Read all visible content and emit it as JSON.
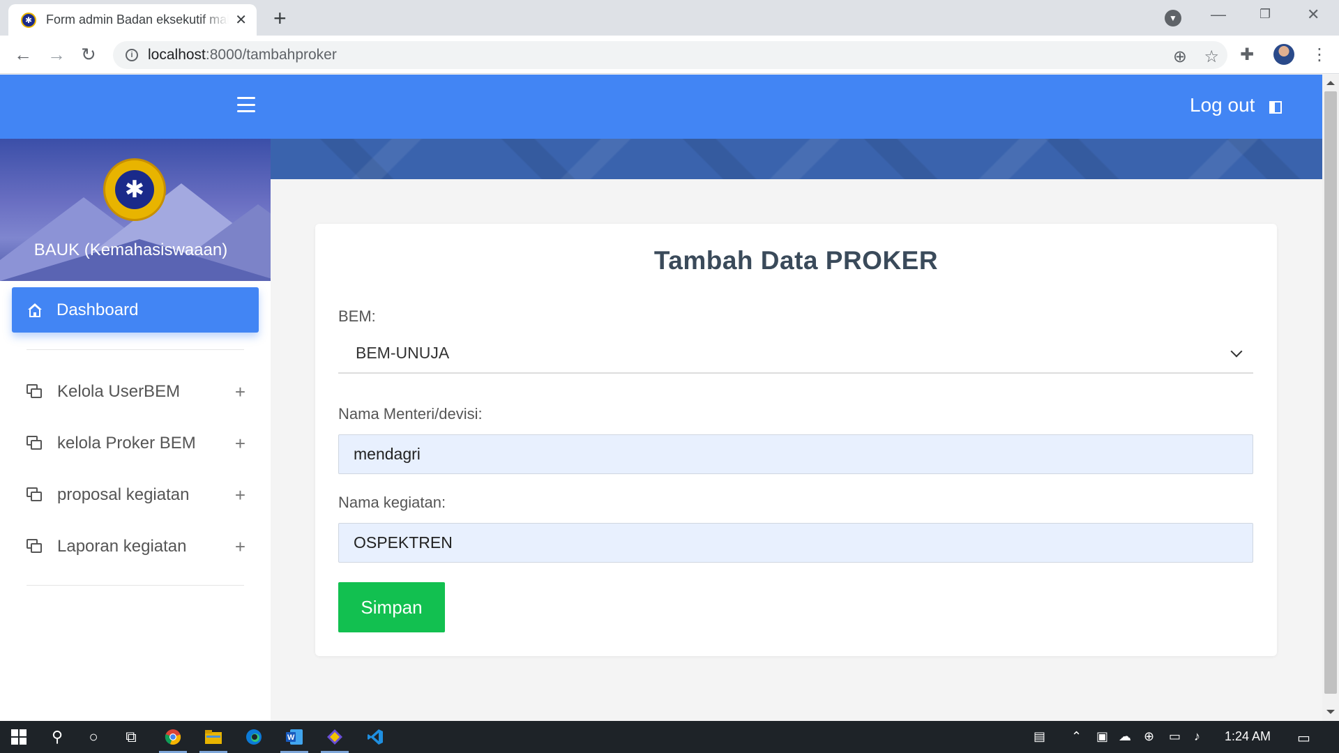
{
  "browser": {
    "tab_title": "Form admin Badan eksekutif mahasiswa",
    "url_host": "localhost",
    "url_path": ":8000/tambahproker",
    "new_tab_symbol": "+",
    "icons": [
      "back-arrow-icon",
      "forward-arrow-icon",
      "reload-icon",
      "info-icon",
      "zoom-icon",
      "star-icon",
      "extensions-icon",
      "menu-dots-icon"
    ]
  },
  "header": {
    "logout_label": "Log out",
    "color": "#4285f4"
  },
  "sidebar": {
    "org_name": "BAUK (Kemahasiswaaan)",
    "active_item": "Dashboard",
    "items": [
      {
        "label": "Kelola UserBEM"
      },
      {
        "label": "kelola Proker BEM"
      },
      {
        "label": "proposal kegiatan"
      },
      {
        "label": "Laporan kegiatan"
      }
    ]
  },
  "form": {
    "title": "Tambah Data PROKER",
    "bem_label": "BEM:",
    "bem_value": "BEM-UNUJA",
    "menteri_label": "Nama Menteri/devisi:",
    "menteri_value": "mendagri",
    "kegiatan_label": "Nama kegiatan:",
    "kegiatan_value": "OSPEKTREN",
    "submit_label": "Simpan",
    "submit_color": "#12c050"
  },
  "taskbar": {
    "time": "1:24 AM"
  }
}
